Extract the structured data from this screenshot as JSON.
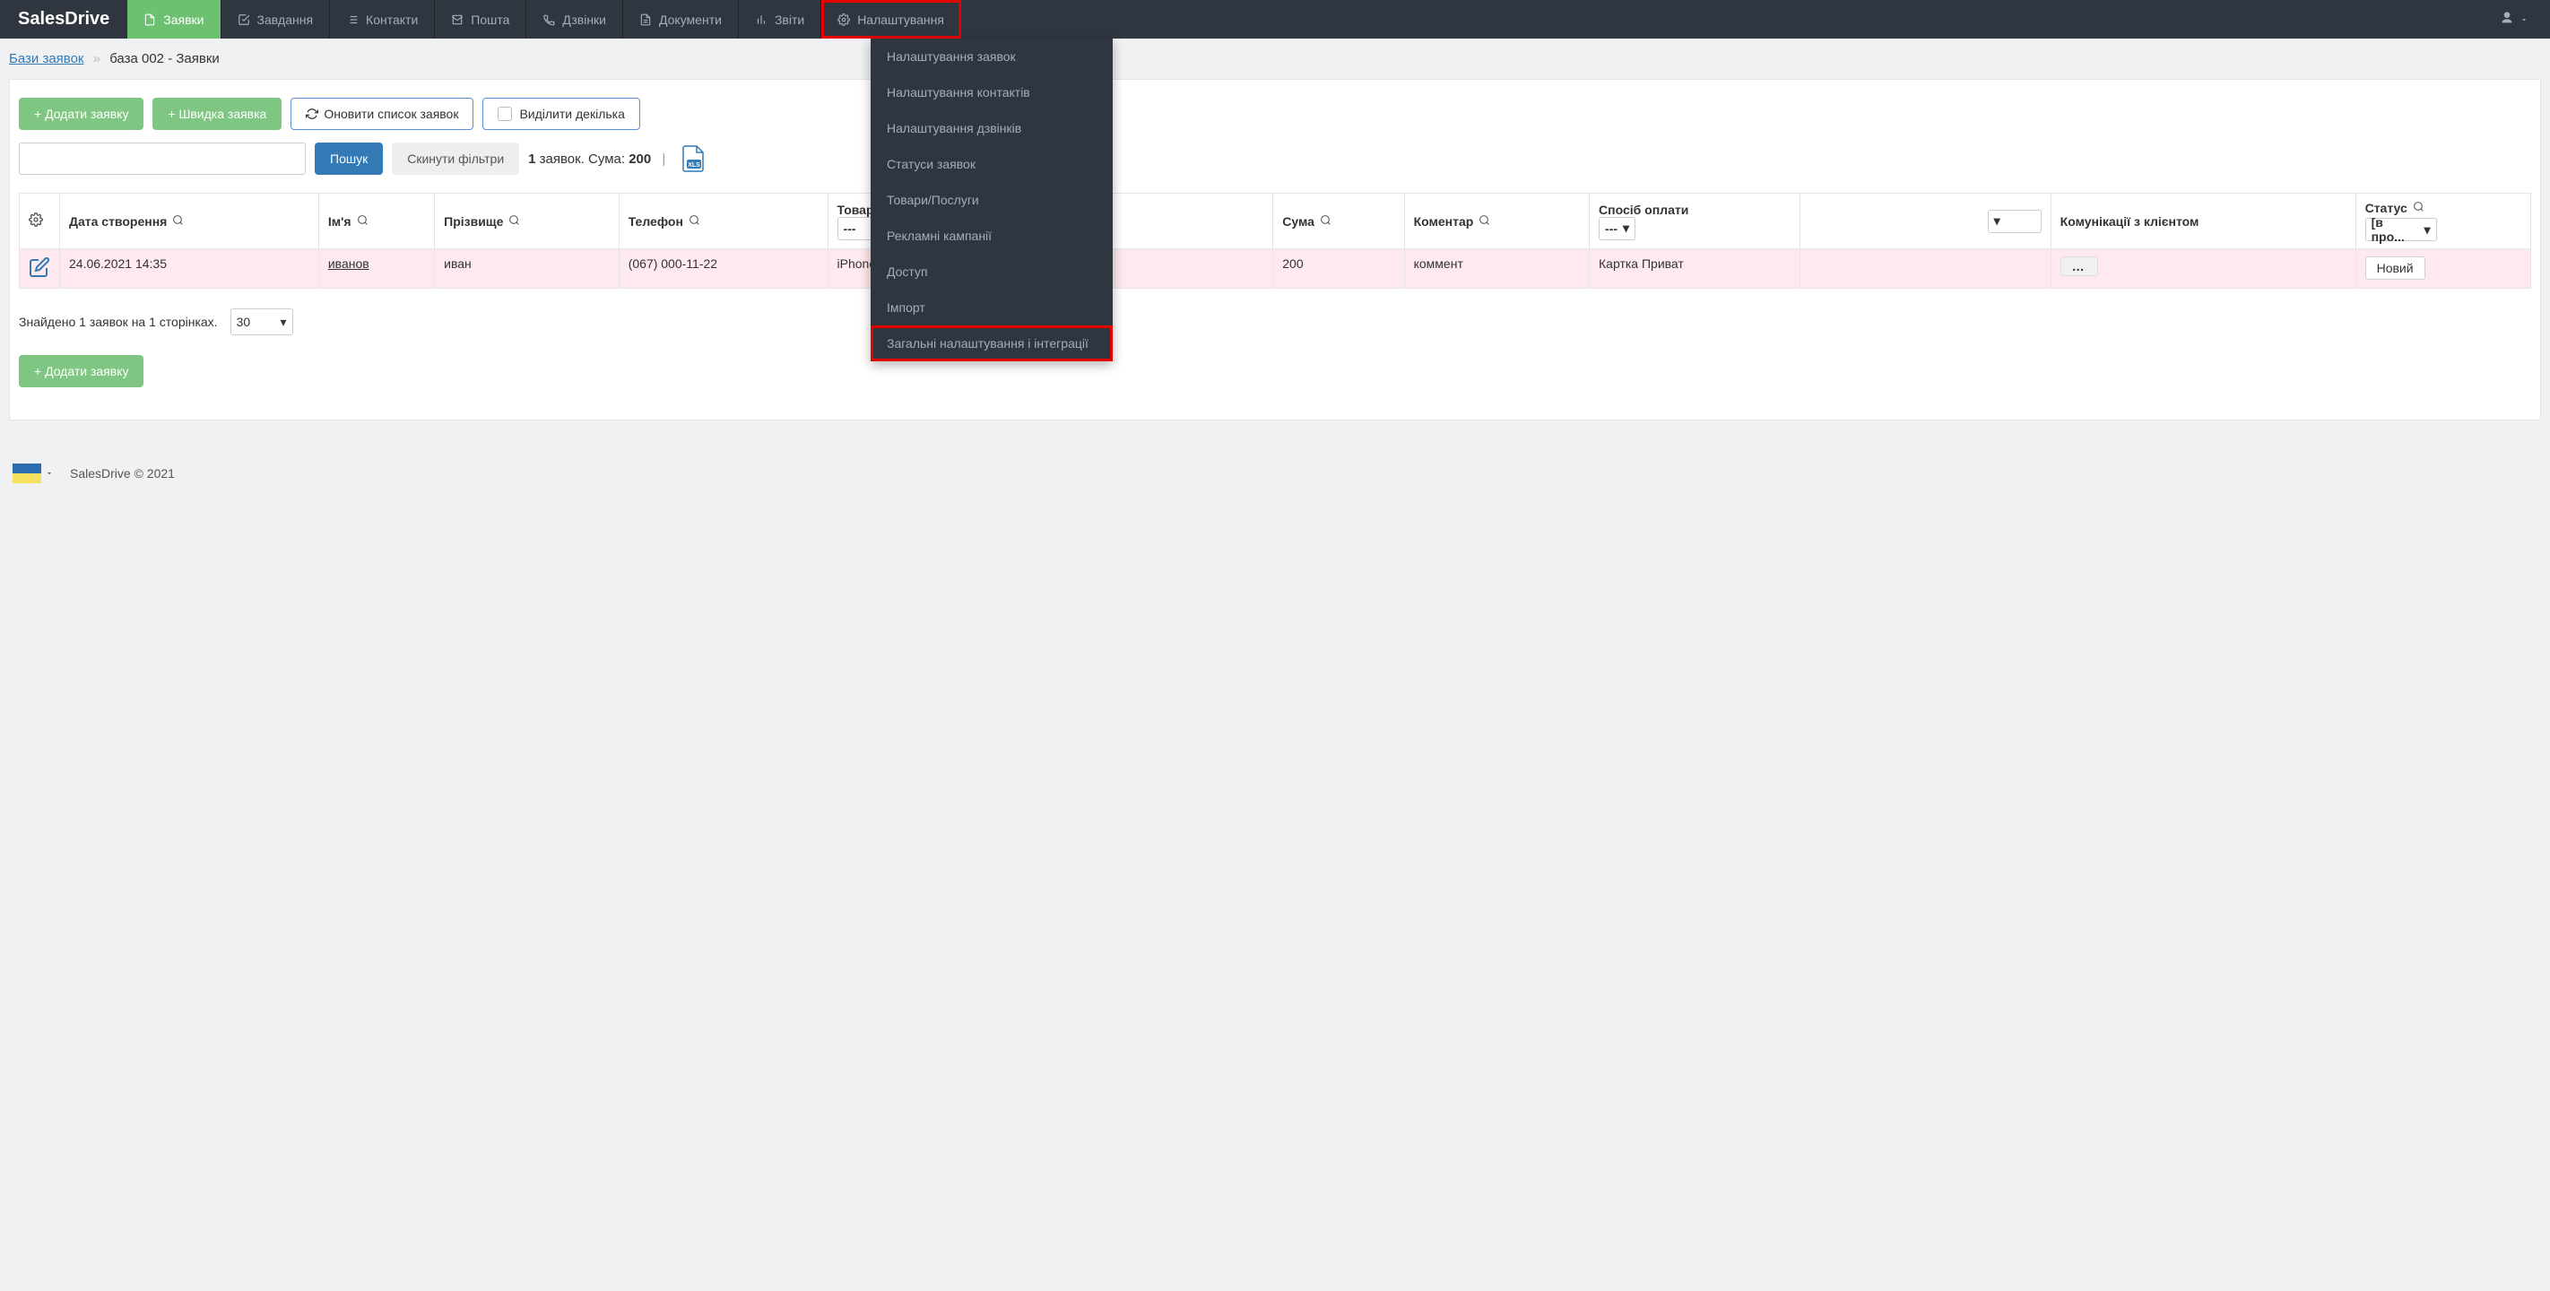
{
  "brand": "SalesDrive",
  "nav": {
    "items": [
      {
        "label": "Заявки",
        "icon": "file"
      },
      {
        "label": "Завдання",
        "icon": "check-square"
      },
      {
        "label": "Контакти",
        "icon": "list"
      },
      {
        "label": "Пошта",
        "icon": "mail"
      },
      {
        "label": "Дзвінки",
        "icon": "phone"
      },
      {
        "label": "Документи",
        "icon": "file-text"
      },
      {
        "label": "Звіти",
        "icon": "bar-chart"
      },
      {
        "label": "Налаштування",
        "icon": "gear"
      }
    ]
  },
  "dropdown": {
    "items": [
      "Налаштування заявок",
      "Налаштування контактів",
      "Налаштування дзвінків",
      "Статуси заявок",
      "Товари/Послуги",
      "Рекламні кампанії",
      "Доступ",
      "Імпорт",
      "Загальні налаштування і інтеграції"
    ]
  },
  "breadcrumb": {
    "root": "Бази заявок",
    "current": "база 002 - Заявки"
  },
  "buttons": {
    "add": "+ Додати заявку",
    "quick": "+ Швидка заявка",
    "refresh": "Оновити список заявок",
    "select_multi": "Виділити декілька",
    "search": "Пошук",
    "reset_filters": "Скинути фільтри",
    "add2": "+ Додати заявку"
  },
  "result": {
    "count": "1",
    "label_mid": " заявок. Сума: ",
    "sum": "200"
  },
  "columns": {
    "date_created": "Дата створення",
    "first_name": "Ім'я",
    "last_name": "Прізвище",
    "phone": "Телефон",
    "goods": "Товари/Послуги",
    "goods_filter": "---",
    "sum": "Сума",
    "comment": "Коментар",
    "pay_method": "Спосіб оплати",
    "pay_filter": "---",
    "communications": "Комунікації з клієнтом",
    "status": "Статус",
    "status_filter": "[в про..."
  },
  "row": {
    "date": "24.06.2021 14:35",
    "firstname": "иванов",
    "lastname": "иван",
    "phone": "(067) 000-11-22",
    "goods": "iPhone XS (214-01) (iPad description)",
    "sum": "200",
    "comment": "коммент",
    "pay": "Картка Приват",
    "comm_dots": "…",
    "status": "Новий"
  },
  "pagination": {
    "found": "Знайдено 1 заявок на 1 сторінках.",
    "per_page": "30"
  },
  "footer": {
    "copyright": "SalesDrive © 2021"
  }
}
